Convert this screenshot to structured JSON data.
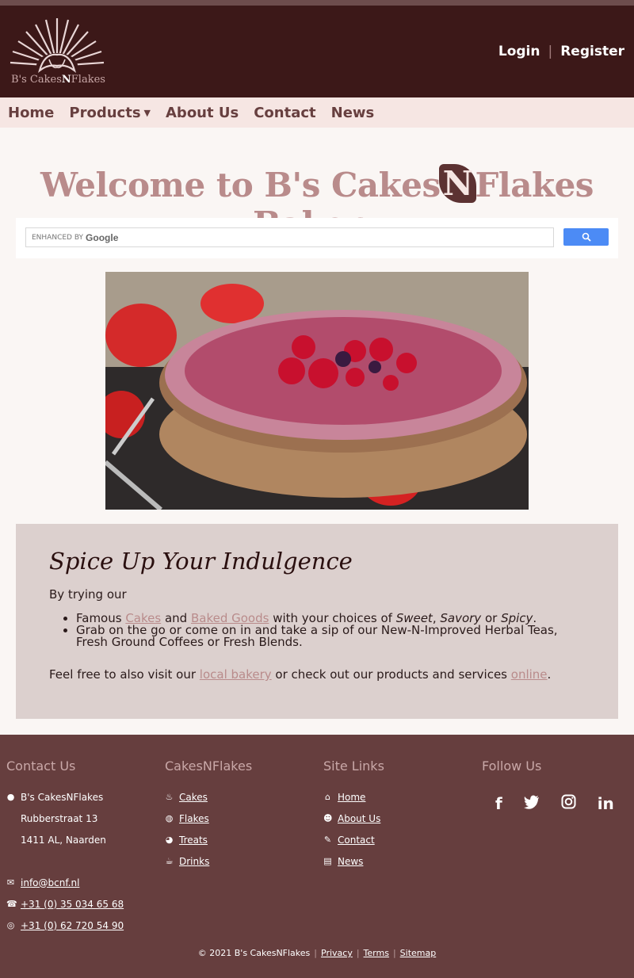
{
  "brand": {
    "logo_text_pre": "B's Cakes",
    "logo_text_n": "N",
    "logo_text_post": "Flakes"
  },
  "auth": {
    "login": "Login",
    "separator": "|",
    "register": "Register"
  },
  "nav": {
    "items": [
      {
        "label": "Home"
      },
      {
        "label": "Products",
        "has_dropdown": true
      },
      {
        "label": "About Us"
      },
      {
        "label": "Contact"
      },
      {
        "label": "News"
      }
    ]
  },
  "welcome": {
    "pre": "Welcome to B's Cakes",
    "n": "N",
    "post": "Flakes Bakery"
  },
  "search": {
    "placeholder_prefix": "ENHANCED BY",
    "placeholder_brand": "Google",
    "button_icon": "search-icon"
  },
  "panel": {
    "heading": "Spice Up Your Indulgence",
    "intro": "By trying our",
    "bullet1": {
      "pre": "Famous ",
      "link1": "Cakes",
      "mid": " and ",
      "link2": "Baked Goods",
      "mid2": " with your choices of ",
      "em1": "Sweet",
      "comma": ", ",
      "em2": "Savory",
      "or": " or ",
      "em3": "Spicy",
      "end": "."
    },
    "bullet2": "Grab on the go or come on in and take a sip of our New-N-Improved Herbal Teas, Fresh Ground Coffees or Fresh Blends.",
    "outro": {
      "pre": "Feel free to also visit our ",
      "link1": "local bakery",
      "mid": " or check out our products and services ",
      "link2": "online",
      "end": "."
    }
  },
  "footer": {
    "contact": {
      "title": "Contact Us",
      "name": "B's CakesNFlakes",
      "street": "Rubberstraat 13",
      "city": "1411 AL, Naarden",
      "email": "info@bcnf.nl",
      "phone": "+31 (0) 35 034 65 68",
      "whatsapp": "+31 (0) 62 720 54 90"
    },
    "products": {
      "title": "CakesNFlakes",
      "items": [
        "Cakes",
        "Flakes",
        "Treats",
        "Drinks"
      ]
    },
    "sitelinks": {
      "title": "Site Links",
      "items": [
        "Home",
        "About Us",
        "Contact",
        "News"
      ]
    },
    "follow": {
      "title": "Follow Us",
      "icons": [
        "facebook-icon",
        "twitter-icon",
        "instagram-icon",
        "linkedin-icon"
      ]
    },
    "copyright": "© 2021 B's CakesNFlakes",
    "legal": [
      "Privacy",
      "Terms",
      "Sitemap"
    ]
  },
  "colors": {
    "header_bg": "#3c1818",
    "nav_bg": "#f6e6e3",
    "accent": "#b98b8b",
    "footer_bg": "#663e3e",
    "search_button": "#4c8bf5"
  }
}
